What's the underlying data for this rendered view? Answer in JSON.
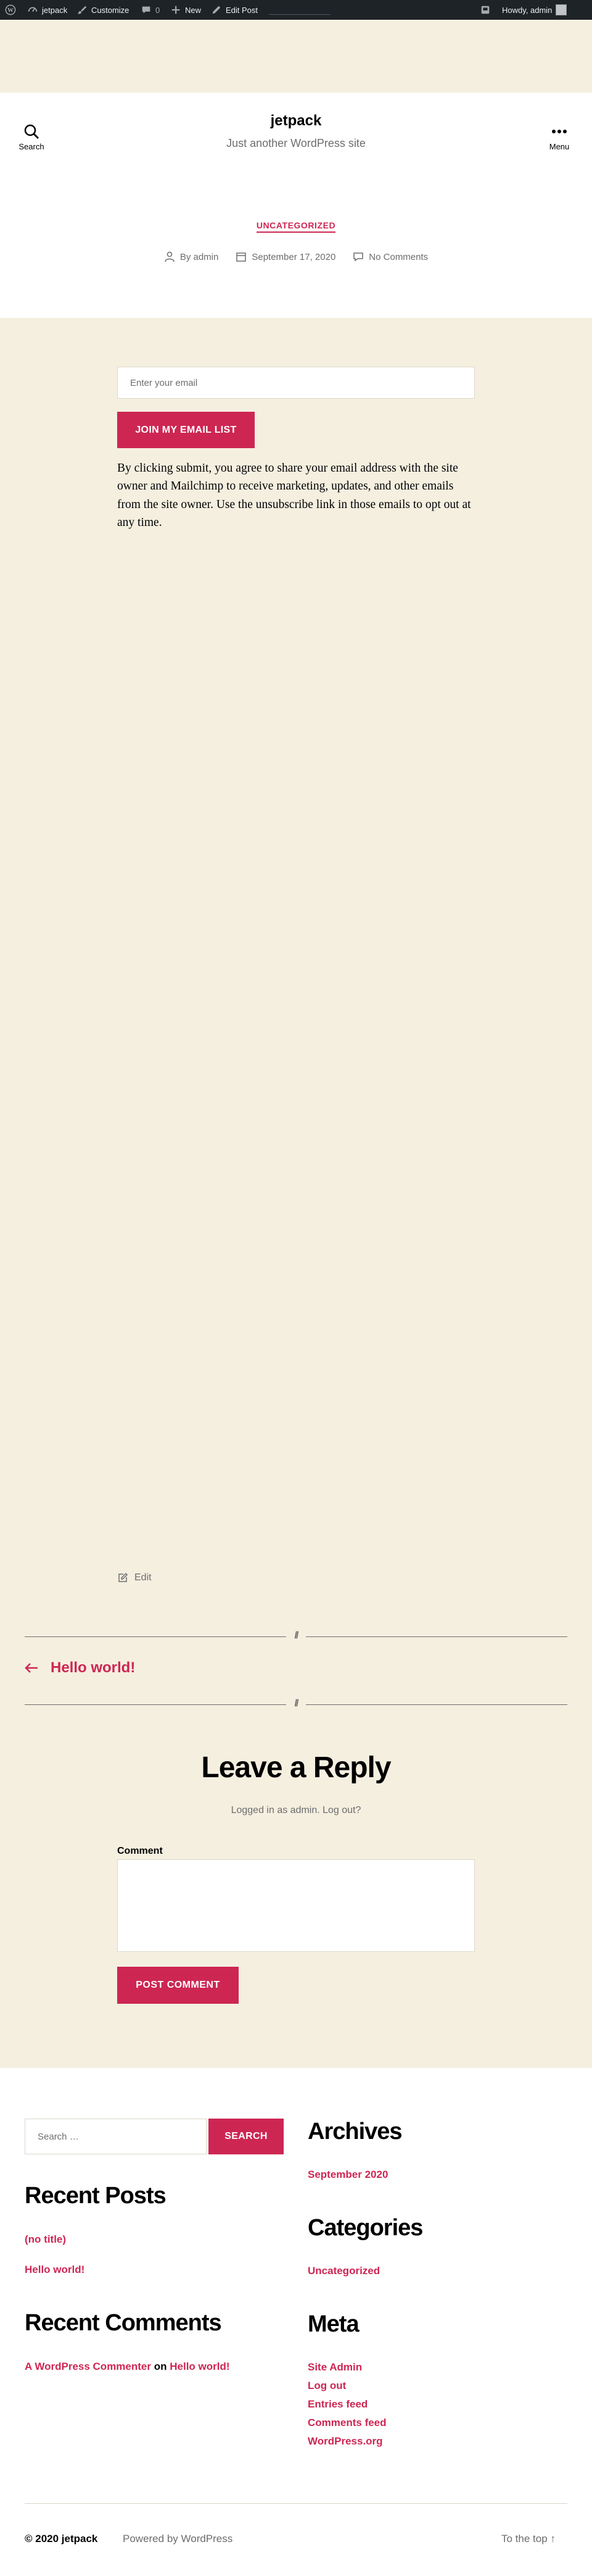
{
  "admin_bar": {
    "site_name": "jetpack",
    "customize": "Customize",
    "comments_count": "0",
    "new": "New",
    "edit_post": "Edit Post",
    "howdy": "Howdy, admin"
  },
  "header": {
    "search_label": "Search",
    "site_title": "jetpack",
    "site_description": "Just another WordPress site",
    "menu_label": "Menu"
  },
  "post": {
    "category": "UNCATEGORIZED",
    "author": "By admin",
    "date": "September 17, 2020",
    "comments": "No Comments"
  },
  "subscribe": {
    "email_placeholder": "Enter your email",
    "button_label": "JOIN MY EMAIL LIST",
    "consent_text": "By clicking submit, you agree to share your email address with the site owner and Mailchimp to receive marketing, updates, and other emails from the site owner. Use the unsubscribe link in those emails to opt out at any time."
  },
  "edit_label": "Edit",
  "separator_mark": "//",
  "nav": {
    "prev_post": "Hello world!"
  },
  "comments": {
    "reply_title": "Leave a Reply",
    "logged_in_text": "Logged in as admin. Log out?",
    "comment_label": "Comment",
    "post_button": "POST COMMENT"
  },
  "footer": {
    "search_placeholder": "Search …",
    "search_button": "SEARCH",
    "recent_posts_title": "Recent Posts",
    "recent_posts": [
      "(no title)",
      "Hello world!"
    ],
    "recent_comments_title": "Recent Comments",
    "recent_comment": {
      "author": "A WordPress Commenter",
      "on": "on",
      "post": "Hello world!"
    },
    "archives_title": "Archives",
    "archives": [
      "September 2020"
    ],
    "categories_title": "Categories",
    "categories": [
      "Uncategorized"
    ],
    "meta_title": "Meta",
    "meta_links": [
      "Site Admin",
      "Log out",
      "Entries feed",
      "Comments feed",
      "WordPress.org"
    ],
    "copyright": "© 2020 jetpack",
    "powered_by": "Powered by WordPress",
    "to_top": "To the top ↑"
  },
  "colors": {
    "accent": "#cd2653",
    "background": "#f5efe0",
    "admin_bar": "#1d2327",
    "muted_text": "#6d6d6d"
  }
}
